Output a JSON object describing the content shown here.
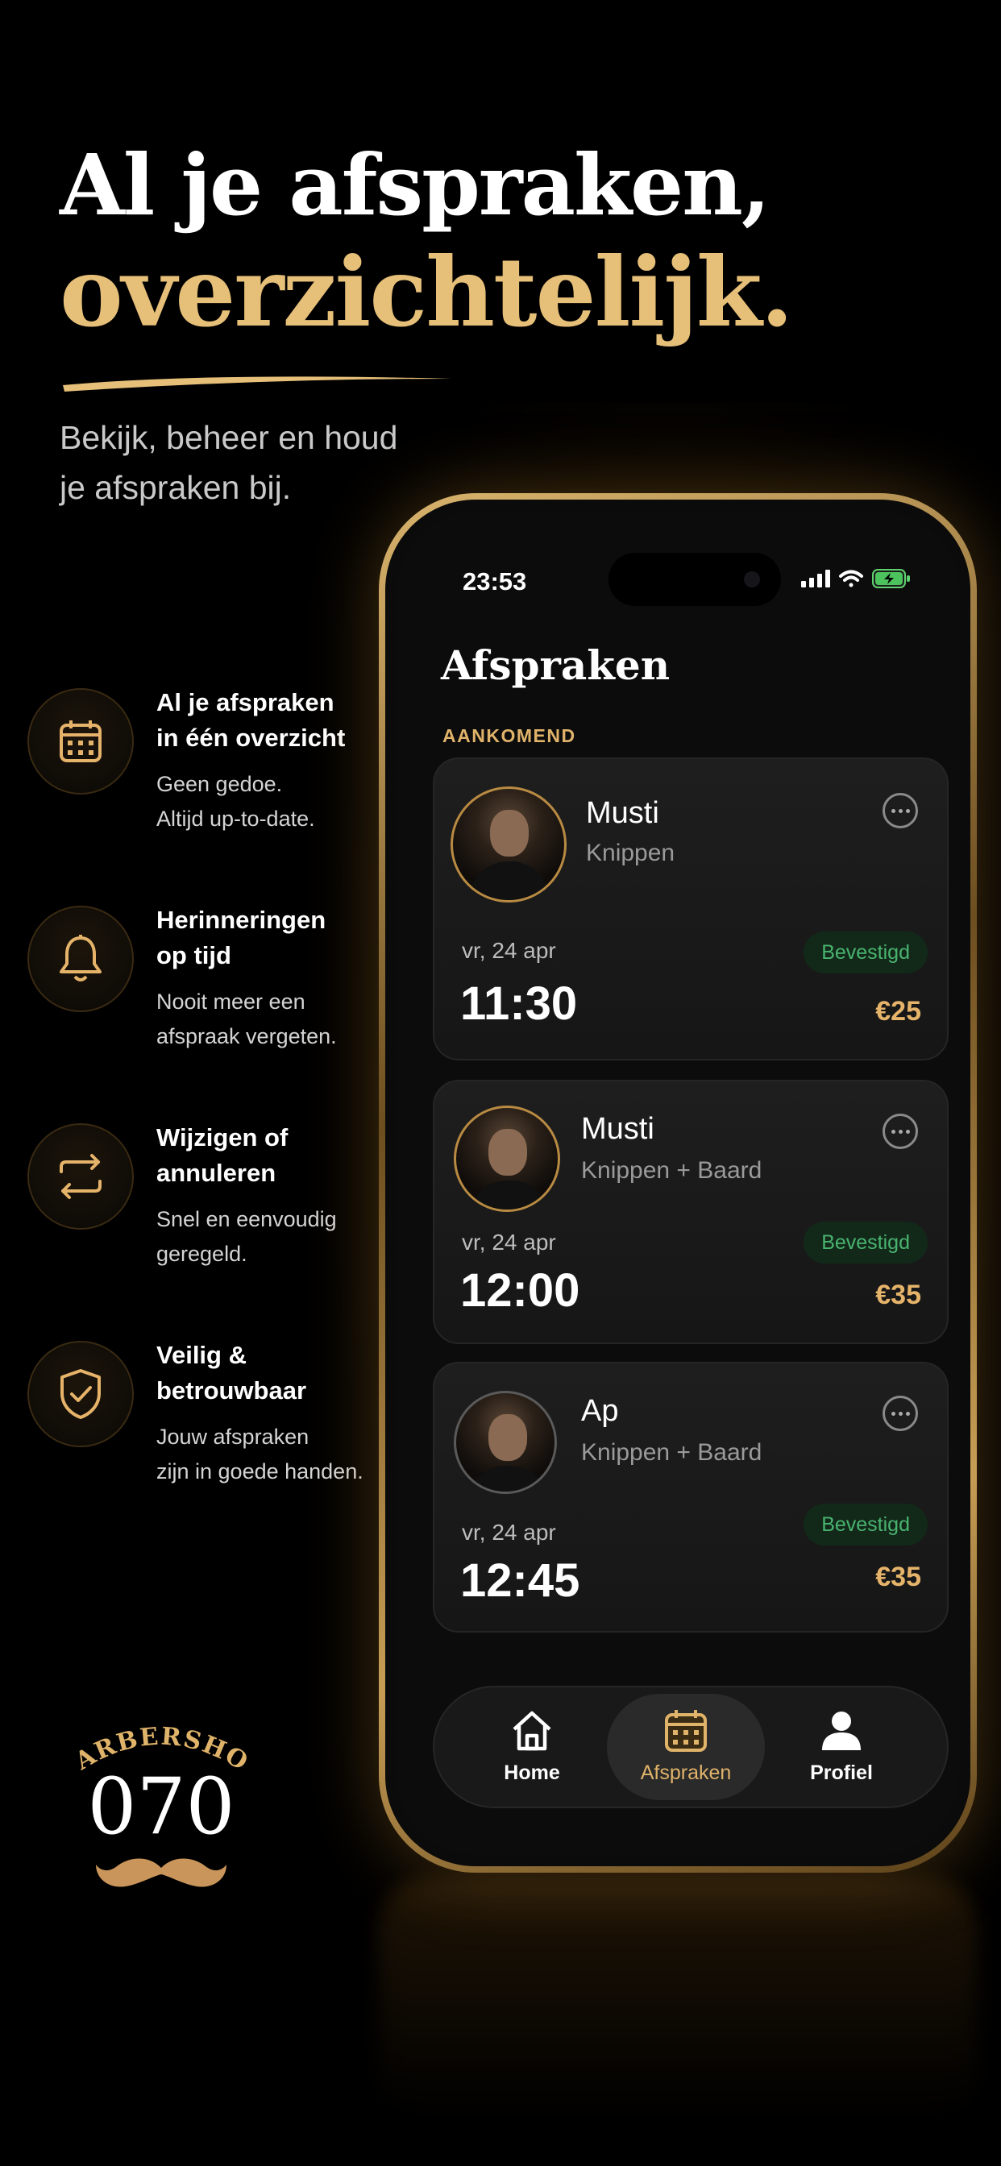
{
  "hero": {
    "title_line1": "Al je afspraken,",
    "title_line2": "overzichtelijk.",
    "subtitle_line1": "Bekijk, beheer en houd",
    "subtitle_line2": "je afspraken bij."
  },
  "features": [
    {
      "icon": "calendar-icon",
      "title_line1": "Al je afspraken",
      "title_line2": "in één overzicht",
      "desc_line1": "Geen gedoe.",
      "desc_line2": "Altijd up-to-date."
    },
    {
      "icon": "bell-icon",
      "title_line1": "Herinneringen",
      "title_line2": "op tijd",
      "desc_line1": "Nooit meer een",
      "desc_line2": "afspraak vergeten."
    },
    {
      "icon": "swap-icon",
      "title_line1": "Wijzigen of",
      "title_line2": "annuleren",
      "desc_line1": "Snel en eenvoudig",
      "desc_line2": "geregeld."
    },
    {
      "icon": "shield-check-icon",
      "title_line1": "Veilig &",
      "title_line2": "betrouwbaar",
      "desc_line1": "Jouw afspraken",
      "desc_line2": "zijn in goede handen."
    }
  ],
  "logo": {
    "arc_text": "BARBERSHOP",
    "number": "070"
  },
  "status_bar": {
    "time": "23:53"
  },
  "screen": {
    "title": "Afspraken",
    "section_label": "AANKOMEND",
    "appointments": [
      {
        "barber": "Musti",
        "service": "Knippen",
        "date": "vr, 24 apr",
        "time": "11:30",
        "status": "Bevestigd",
        "price": "€25"
      },
      {
        "barber": "Musti",
        "service": "Knippen + Baard",
        "date": "vr, 24 apr",
        "time": "12:00",
        "status": "Bevestigd",
        "price": "€35"
      },
      {
        "barber": "Ap",
        "service": "Knippen + Baard",
        "date": "vr, 24 apr",
        "time": "12:45",
        "status": "Bevestigd",
        "price": "€35"
      }
    ]
  },
  "tabbar": {
    "items": [
      {
        "label": "Home",
        "icon": "home-icon",
        "active": false
      },
      {
        "label": "Afspraken",
        "icon": "calendar-icon",
        "active": true
      },
      {
        "label": "Profiel",
        "icon": "person-icon",
        "active": false
      }
    ]
  },
  "colors": {
    "gold": "#e6bf78",
    "confirmed_green": "#49b36f",
    "background": "#000000"
  }
}
